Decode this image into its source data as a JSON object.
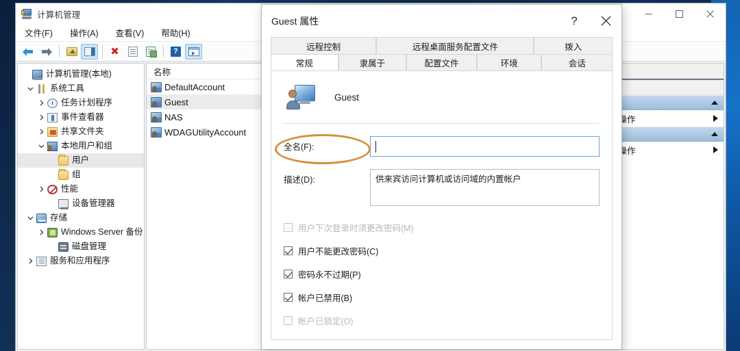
{
  "desktop": {
    "bg_color": "#0e2c55",
    "glow_color": "#1573c8"
  },
  "main_window": {
    "title": "计算机管理",
    "title_icon": "computer-management-icon",
    "window_controls": {
      "minimize": "–",
      "maximize": "□",
      "close": "✕"
    },
    "menu": [
      {
        "label": "文件(F)"
      },
      {
        "label": "操作(A)"
      },
      {
        "label": "查看(V)"
      },
      {
        "label": "帮助(H)"
      }
    ],
    "toolbar": [
      {
        "name": "back-button",
        "icon": "back-arrow-icon"
      },
      {
        "name": "forward-button",
        "icon": "forward-arrow-icon"
      },
      {
        "name": "up-folder-button",
        "icon": "folder-up-icon"
      },
      {
        "name": "show-hide-console-tree-button",
        "icon": "console-pane-icon",
        "pressed": true
      },
      {
        "name": "delete-button",
        "icon": "red-x-icon"
      },
      {
        "name": "properties-button",
        "icon": "properties-doc-icon"
      },
      {
        "name": "export-list-button",
        "icon": "export-doc-icon"
      },
      {
        "name": "help-button",
        "icon": "question-mark-icon"
      },
      {
        "name": "show-hide-action-pane-button",
        "icon": "action-pane-icon",
        "pressed": true
      }
    ]
  },
  "tree": {
    "items": [
      {
        "label": "计算机管理(本地)",
        "indent": 0,
        "twisty": "none",
        "icon": "computer"
      },
      {
        "label": "系统工具",
        "indent": 1,
        "twisty": "expanded",
        "icon": "tools"
      },
      {
        "label": "任务计划程序",
        "indent": 2,
        "twisty": "collapsed",
        "icon": "clock"
      },
      {
        "label": "事件查看器",
        "indent": 2,
        "twisty": "collapsed",
        "icon": "evt"
      },
      {
        "label": "共享文件夹",
        "indent": 2,
        "twisty": "collapsed",
        "icon": "shared"
      },
      {
        "label": "本地用户和组",
        "indent": 2,
        "twisty": "expanded",
        "icon": "users"
      },
      {
        "label": "用户",
        "indent": 3,
        "twisty": "none",
        "icon": "folder",
        "selected": true
      },
      {
        "label": "组",
        "indent": 3,
        "twisty": "none",
        "icon": "folder"
      },
      {
        "label": "性能",
        "indent": 2,
        "twisty": "collapsed",
        "icon": "perf"
      },
      {
        "label": "设备管理器",
        "indent": 2,
        "twisty": "none",
        "icon": "device"
      },
      {
        "label": "存储",
        "indent": 1,
        "twisty": "expanded",
        "icon": "storage"
      },
      {
        "label": "Windows Server 备份",
        "indent": 2,
        "twisty": "collapsed",
        "icon": "backup"
      },
      {
        "label": "磁盘管理",
        "indent": 2,
        "twisty": "none",
        "icon": "disk"
      },
      {
        "label": "服务和应用程序",
        "indent": 1,
        "twisty": "collapsed",
        "icon": "services"
      }
    ]
  },
  "list": {
    "column_header": "名称",
    "rows": [
      {
        "name": "DefaultAccount",
        "selected": false
      },
      {
        "name": "Guest",
        "selected": true
      },
      {
        "name": "NAS",
        "selected": false
      },
      {
        "name": "WDAGUtilityAccount",
        "selected": false
      }
    ]
  },
  "action_pane": {
    "groups": [
      {
        "more_actions_label": "多操作"
      },
      {
        "more_actions_label": "多操作"
      }
    ]
  },
  "dialog": {
    "title": "Guest 属性",
    "help_glyph": "?",
    "close_glyph": "✕",
    "tabs_row1": [
      {
        "label": "远程控制",
        "active": false
      },
      {
        "label": "远程桌面服务配置文件",
        "active": false
      },
      {
        "label": "拨入",
        "active": false
      }
    ],
    "tabs_row2": [
      {
        "label": "常规",
        "active": true
      },
      {
        "label": "隶属于",
        "active": false
      },
      {
        "label": "配置文件",
        "active": false
      },
      {
        "label": "环境",
        "active": false
      },
      {
        "label": "会话",
        "active": false
      }
    ],
    "identity": {
      "icon": "user-account-icon",
      "username": "Guest"
    },
    "fields": [
      {
        "label": "全名(F):",
        "value": "",
        "multiline": false,
        "focused": true
      },
      {
        "label": "描述(D):",
        "value": "供来宾访问计算机或访问域的内置帐户",
        "multiline": true,
        "focused": false
      }
    ],
    "checkboxes": [
      {
        "label": "用户下次登录时须更改密码(M)",
        "checked": false,
        "disabled": true
      },
      {
        "label": "用户不能更改密码(C)",
        "checked": true,
        "disabled": false
      },
      {
        "label": "密码永不过期(P)",
        "checked": true,
        "disabled": false
      },
      {
        "label": "帐户已禁用(B)",
        "checked": true,
        "disabled": false,
        "highlighted": true
      },
      {
        "label": "帐户已锁定(O)",
        "checked": false,
        "disabled": true
      }
    ],
    "annotation": {
      "shape": "ellipse",
      "color": "#d4913f",
      "targets": "帐户已禁用(B)"
    }
  }
}
